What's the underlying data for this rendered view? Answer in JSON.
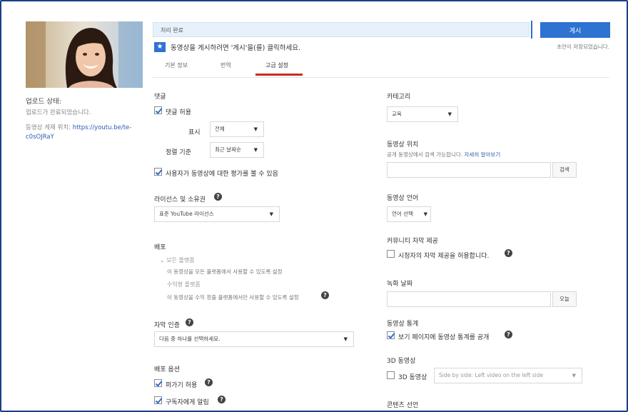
{
  "header": {
    "status_bar_text": "처리 완료",
    "publish_label": "게시",
    "saved_text": "초안이 저장되었습니다.",
    "instruction": "동영상을 게시하려면 '게시'을(를) 클릭하세요."
  },
  "tabs": [
    {
      "label": "기본 정보"
    },
    {
      "label": "번역"
    },
    {
      "label": "고급 설정"
    }
  ],
  "sidebar": {
    "upload_status_label": "업로드 상태:",
    "upload_status_value": "업로드가 완료되었습니다.",
    "video_link_label": "동영상 게재 위치:",
    "video_link_url": "https://youtu.be/te-c0sOJRaY"
  },
  "left": {
    "comments_heading": "댓글",
    "allow_comments": "댓글 허용",
    "show_label": "표시",
    "show_value": "전체",
    "sort_label": "정렬 기준",
    "sort_value": "최근 날짜순",
    "ratings_label": "사용자가 동영상에 대한 평가를 볼 수 있음",
    "license_heading": "라이선스 및 소유권",
    "license_value": "표준 YouTube 라이선스",
    "distribution_heading": "배포",
    "dist_all_label": "모든 플랫폼",
    "dist_all_desc": "이 동영상을 모든 플랫폼에서 사용할 수 있도록 설정",
    "dist_monetized_label": "수익형 플랫폼",
    "dist_monetized_desc": "이 동영상을 수익 창출 플랫폼에서만 사용할 수 있도록 설정",
    "caption_cert_heading": "자막 인증",
    "caption_cert_value": "다음 중 하나를 선택하세요.",
    "broadcast_heading": "배포 옵션",
    "allow_embed": "퍼가기 허용",
    "notify_subscribers": "구독자에게 알림"
  },
  "right": {
    "category_heading": "카테고리",
    "category_value": "교육",
    "location_heading": "동영상 위치",
    "location_desc": "공개 동영상에서 검색 가능합니다.",
    "location_link": "자세히 알아보기",
    "search_button": "검색",
    "language_heading": "동영상 언어",
    "language_value": "언어 선택",
    "community_heading": "커뮤니티 자막 제공",
    "community_label": "시청자의 자막 제공을 허용합니다.",
    "recording_date_heading": "녹화 날짜",
    "today_button": "오늘",
    "stats_heading": "동영상 통계",
    "stats_label": "보기 페이지에 동영상 통계를 공개",
    "video3d_heading": "3D 동영상",
    "video3d_label": "3D 동영상",
    "video3d_value": "Side by side: Left video on the left side",
    "content_heading": "콘텐츠 선언"
  },
  "colors": {
    "accent": "#2e72d2",
    "tab_active_underline": "#cc2a22",
    "frame": "#1a3f86"
  }
}
